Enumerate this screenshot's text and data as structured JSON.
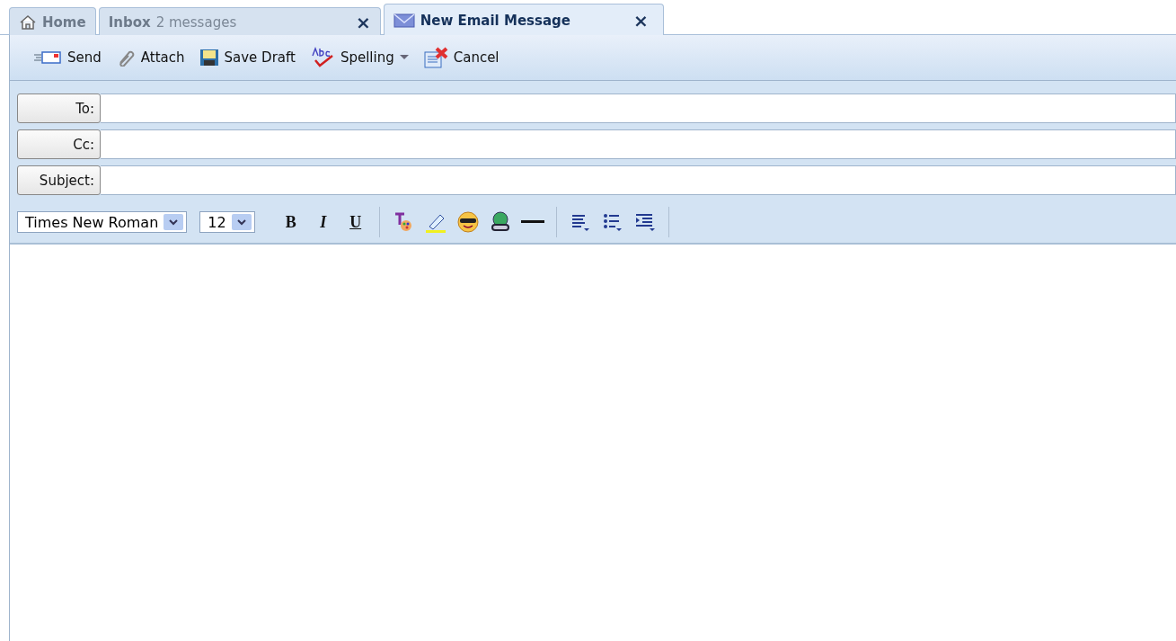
{
  "tabs": [
    {
      "kind": "home",
      "label": "Home",
      "selected": false
    },
    {
      "kind": "inbox",
      "label": "Inbox",
      "note": "2 messages",
      "selected": false,
      "close": "×"
    },
    {
      "kind": "mail",
      "label": "New Email Message",
      "selected": true,
      "close": "×"
    }
  ],
  "toolbar": [
    {
      "kind": "send",
      "label": "Send"
    },
    {
      "kind": "attach",
      "label": "Attach"
    },
    {
      "kind": "save",
      "label": "Save Draft"
    },
    {
      "kind": "spelling",
      "label": "Spelling"
    },
    {
      "kind": "cancel",
      "label": "Cancel"
    }
  ],
  "fields": [
    {
      "label": "To:"
    },
    {
      "label": "Cc:"
    },
    {
      "label": "Subject:"
    }
  ],
  "format": {
    "font": "Times New Roman",
    "size": "12",
    "buttons": [
      {
        "kind": "bold",
        "label": "B"
      },
      {
        "kind": "italic",
        "label": "I"
      },
      {
        "kind": "underline",
        "label": "U"
      },
      {
        "kind": "sep"
      },
      {
        "kind": "color"
      },
      {
        "kind": "highlight"
      },
      {
        "kind": "emoticon"
      },
      {
        "kind": "link"
      },
      {
        "kind": "rule"
      },
      {
        "kind": "sep"
      },
      {
        "kind": "align"
      },
      {
        "kind": "list"
      },
      {
        "kind": "indent"
      },
      {
        "kind": "sep"
      }
    ]
  }
}
